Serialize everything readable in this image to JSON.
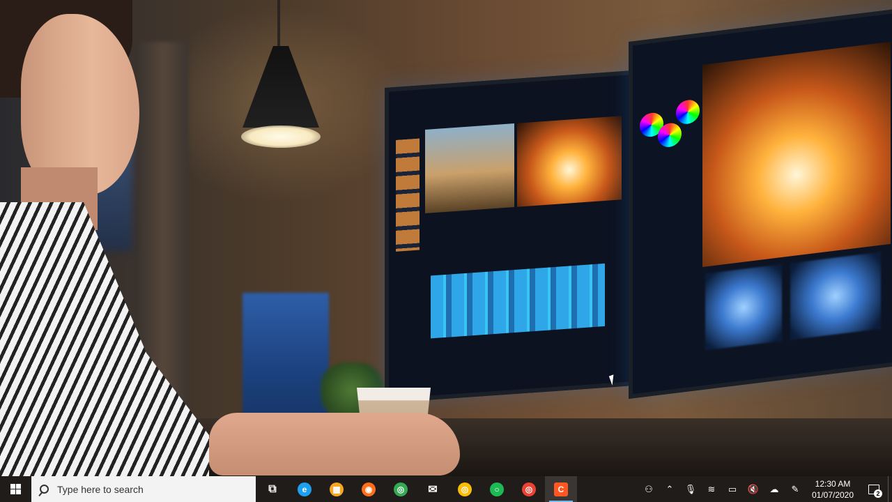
{
  "taskbar": {
    "start_icon": "windows-logo-icon",
    "search": {
      "placeholder": "Type here to search",
      "icon": "search-icon"
    },
    "apps": [
      {
        "name": "task-view",
        "icon": "task-view-icon",
        "color": "#ffffff",
        "glyph": "⧉"
      },
      {
        "name": "internet-explorer",
        "icon": "internet-explorer-icon",
        "color": "#1ea0f0",
        "glyph": "e"
      },
      {
        "name": "microsoft-store",
        "icon": "store-icon",
        "color": "#f5a623",
        "glyph": "▦"
      },
      {
        "name": "firefox",
        "icon": "firefox-icon",
        "color": "#ff6f1a",
        "glyph": "◉"
      },
      {
        "name": "chrome",
        "icon": "chrome-icon",
        "color": "#34a853",
        "glyph": "◎"
      },
      {
        "name": "mail",
        "icon": "mail-icon",
        "color": "#ffffff",
        "glyph": "✉"
      },
      {
        "name": "chrome-variant",
        "icon": "chrome-color-icon",
        "color": "#fbbc05",
        "glyph": "◎"
      },
      {
        "name": "green-app",
        "icon": "green-ring-icon",
        "color": "#1db954",
        "glyph": "○"
      },
      {
        "name": "chrome-profile",
        "icon": "chrome-profile-icon",
        "color": "#ea4335",
        "glyph": "◎"
      },
      {
        "name": "camtasia",
        "icon": "recorder-icon",
        "color": "#ff5722",
        "glyph": "C"
      }
    ],
    "tray": {
      "icons": [
        {
          "name": "people",
          "icon": "people-icon",
          "glyph": "⚇"
        },
        {
          "name": "show-hidden",
          "icon": "chevron-up-icon",
          "glyph": "⌃"
        },
        {
          "name": "microphone",
          "icon": "microphone-icon",
          "glyph": "🎙"
        },
        {
          "name": "network",
          "icon": "wifi-icon",
          "glyph": "≋"
        },
        {
          "name": "battery",
          "icon": "battery-icon",
          "glyph": "▭"
        },
        {
          "name": "volume",
          "icon": "volume-muted-icon",
          "glyph": "🔇"
        },
        {
          "name": "onedrive",
          "icon": "cloud-icon",
          "glyph": "☁"
        },
        {
          "name": "pen",
          "icon": "pen-icon",
          "glyph": "✎"
        }
      ],
      "time": "12:30 AM",
      "date": "01/07/2020",
      "notification_count": "2"
    }
  },
  "colors": {
    "taskbar_bg": "#1f1c1a",
    "search_bg": "#f3f3f3",
    "accent": "#76b9ed"
  }
}
